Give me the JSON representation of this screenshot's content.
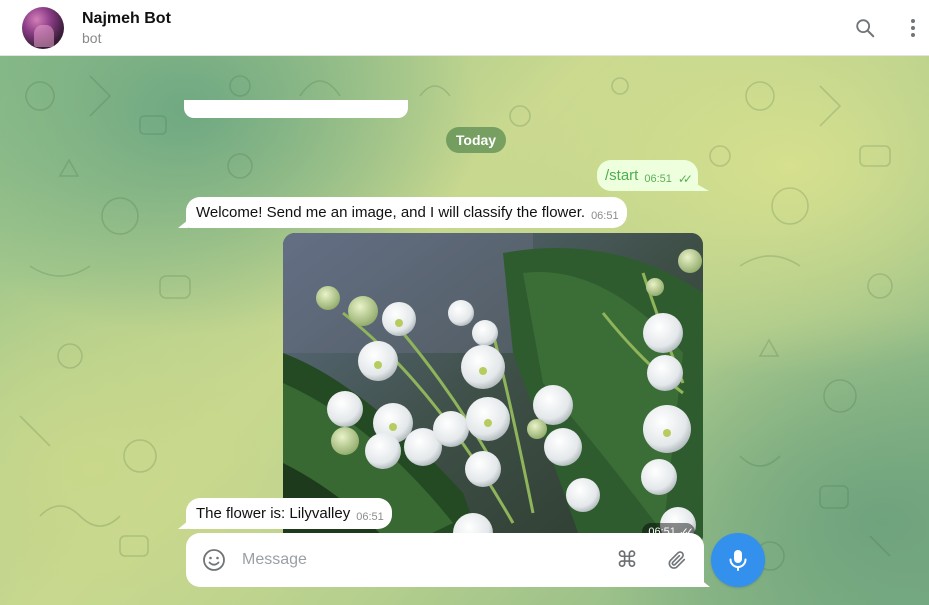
{
  "header": {
    "title": "Najmeh Bot",
    "subtitle": "bot"
  },
  "chat": {
    "date_label": "Today",
    "messages": [
      {
        "direction": "outgoing",
        "text": "/start",
        "time": "06:51",
        "status": "read"
      },
      {
        "direction": "incoming",
        "text": "Welcome! Send me an image, and I will classify the flower.",
        "time": "06:51"
      },
      {
        "direction": "outgoing",
        "type": "photo",
        "time": "06:51",
        "status": "read"
      },
      {
        "direction": "incoming",
        "text": "The flower is: Lilyvalley",
        "time": "06:51"
      }
    ]
  },
  "composer": {
    "placeholder": "Message",
    "value": ""
  },
  "icons": {
    "search": "search-icon",
    "more": "more-vertical-icon",
    "emoji": "emoji-icon",
    "command": "command-icon",
    "attach": "paperclip-icon",
    "mic": "microphone-icon",
    "read_receipt": "double-check-icon"
  },
  "colors": {
    "outgoing_bubble": "#eeffde",
    "outgoing_text": "#4fae4e",
    "accent": "#3390ec",
    "date_pill": "#5c8c52"
  }
}
